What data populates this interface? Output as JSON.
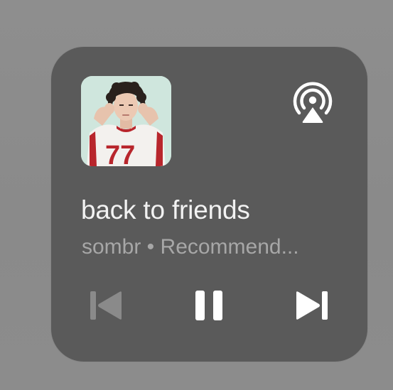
{
  "now_playing": {
    "title": "back to friends",
    "subtitle": "sombr • Recommend..."
  },
  "icons": {
    "airplay": "airplay-icon",
    "previous": "previous-track-icon",
    "pause": "pause-icon",
    "next": "next-track-icon"
  },
  "colors": {
    "background": "#8c8c8c",
    "widget": "#5a5a5a",
    "title": "#f2f2f2",
    "subtitle": "#a7a7a7",
    "icon_active": "#ffffff",
    "icon_disabled": "#8a8a8a"
  },
  "controls": {
    "previous_enabled": false,
    "playing": true
  }
}
